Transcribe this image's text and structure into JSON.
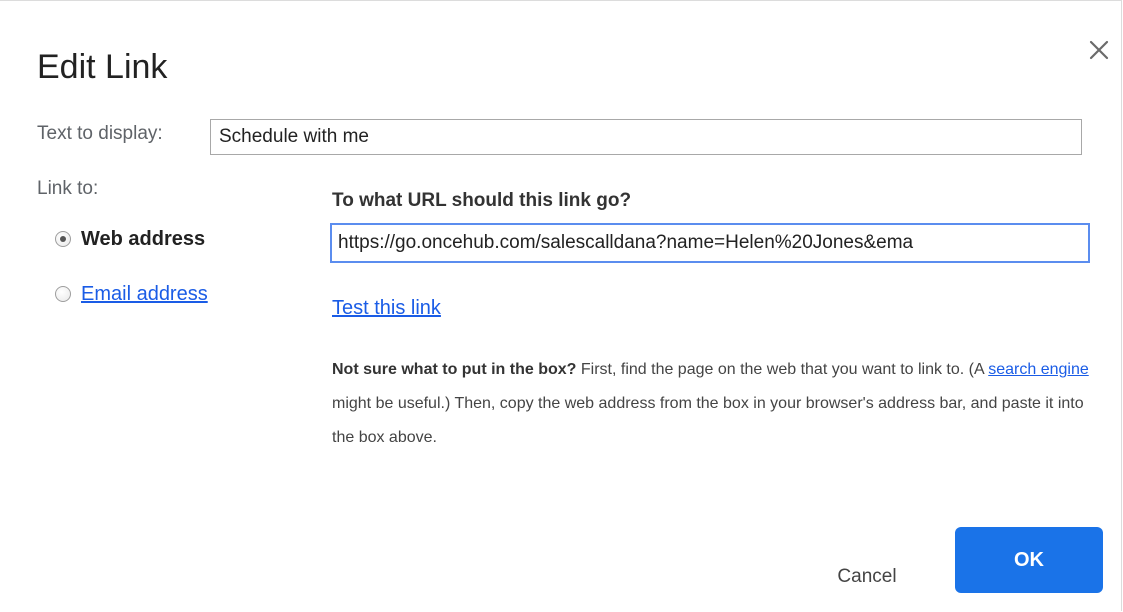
{
  "dialog": {
    "title": "Edit Link",
    "close_icon": "close-icon"
  },
  "text_to_display": {
    "label": "Text to display:",
    "value": "Schedule with me"
  },
  "link_to": {
    "label": "Link to:",
    "options": [
      {
        "label": "Web address",
        "selected": true
      },
      {
        "label": "Email address",
        "selected": false
      }
    ]
  },
  "url_section": {
    "heading": "To what URL should this link go?",
    "value": "https://go.oncehub.com/salescalldana?name=Helen%20Jones&ema",
    "test_link": "Test this link"
  },
  "help": {
    "bold_lead": "Not sure what to put in the box?",
    "part1": " First, find the page on the web that you want to link to. (A ",
    "link_text": "search engine",
    "part2": " might be useful.) Then, copy the web address from the box in your browser's address bar, and paste it into the box above."
  },
  "buttons": {
    "cancel": "Cancel",
    "ok": "OK"
  },
  "colors": {
    "accent": "#1a73e8",
    "link": "#1a5ce6"
  }
}
